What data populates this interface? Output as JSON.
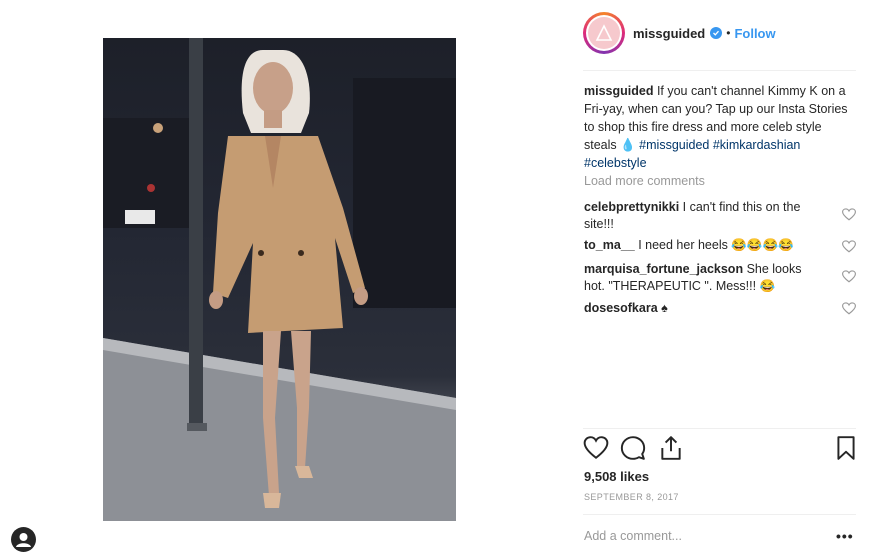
{
  "post": {
    "username": "missguided",
    "follow_label": "Follow",
    "separator": "•",
    "caption_user": "missguided",
    "caption_text": " If you can't channel Kimmy K on a Fri-yay, when can you? Tap up our Insta Stories to shop this fire dress and more celeb style steals 💧 ",
    "hashtags": [
      "#missguided",
      "#kimkardashian",
      "#celebstyle"
    ],
    "load_more": "Load more comments",
    "comments": [
      {
        "user": "celebprettynikki",
        "text": " I can't find this on the site!!!"
      },
      {
        "user": "to_ma__",
        "text": " I need her heels 😂😂😂😂"
      },
      {
        "user": "marquisa_fortune_jackson",
        "text": " She looks hot. \"THERAPEUTIC \". Mess!!! 😂"
      },
      {
        "user": "dosesofkara",
        "text": " ♠"
      }
    ],
    "likes": "9,508 likes",
    "date": "SEPTEMBER 8, 2017",
    "add_comment_placeholder": "Add a comment...",
    "more_options": "•••"
  },
  "colors": {
    "link": "#3897f0",
    "hashtag": "#003569",
    "muted": "#999999",
    "text": "#262626"
  },
  "icons": [
    "heart-icon",
    "comment-icon",
    "share-icon",
    "bookmark-icon",
    "verified-icon",
    "user-avatar-icon"
  ]
}
